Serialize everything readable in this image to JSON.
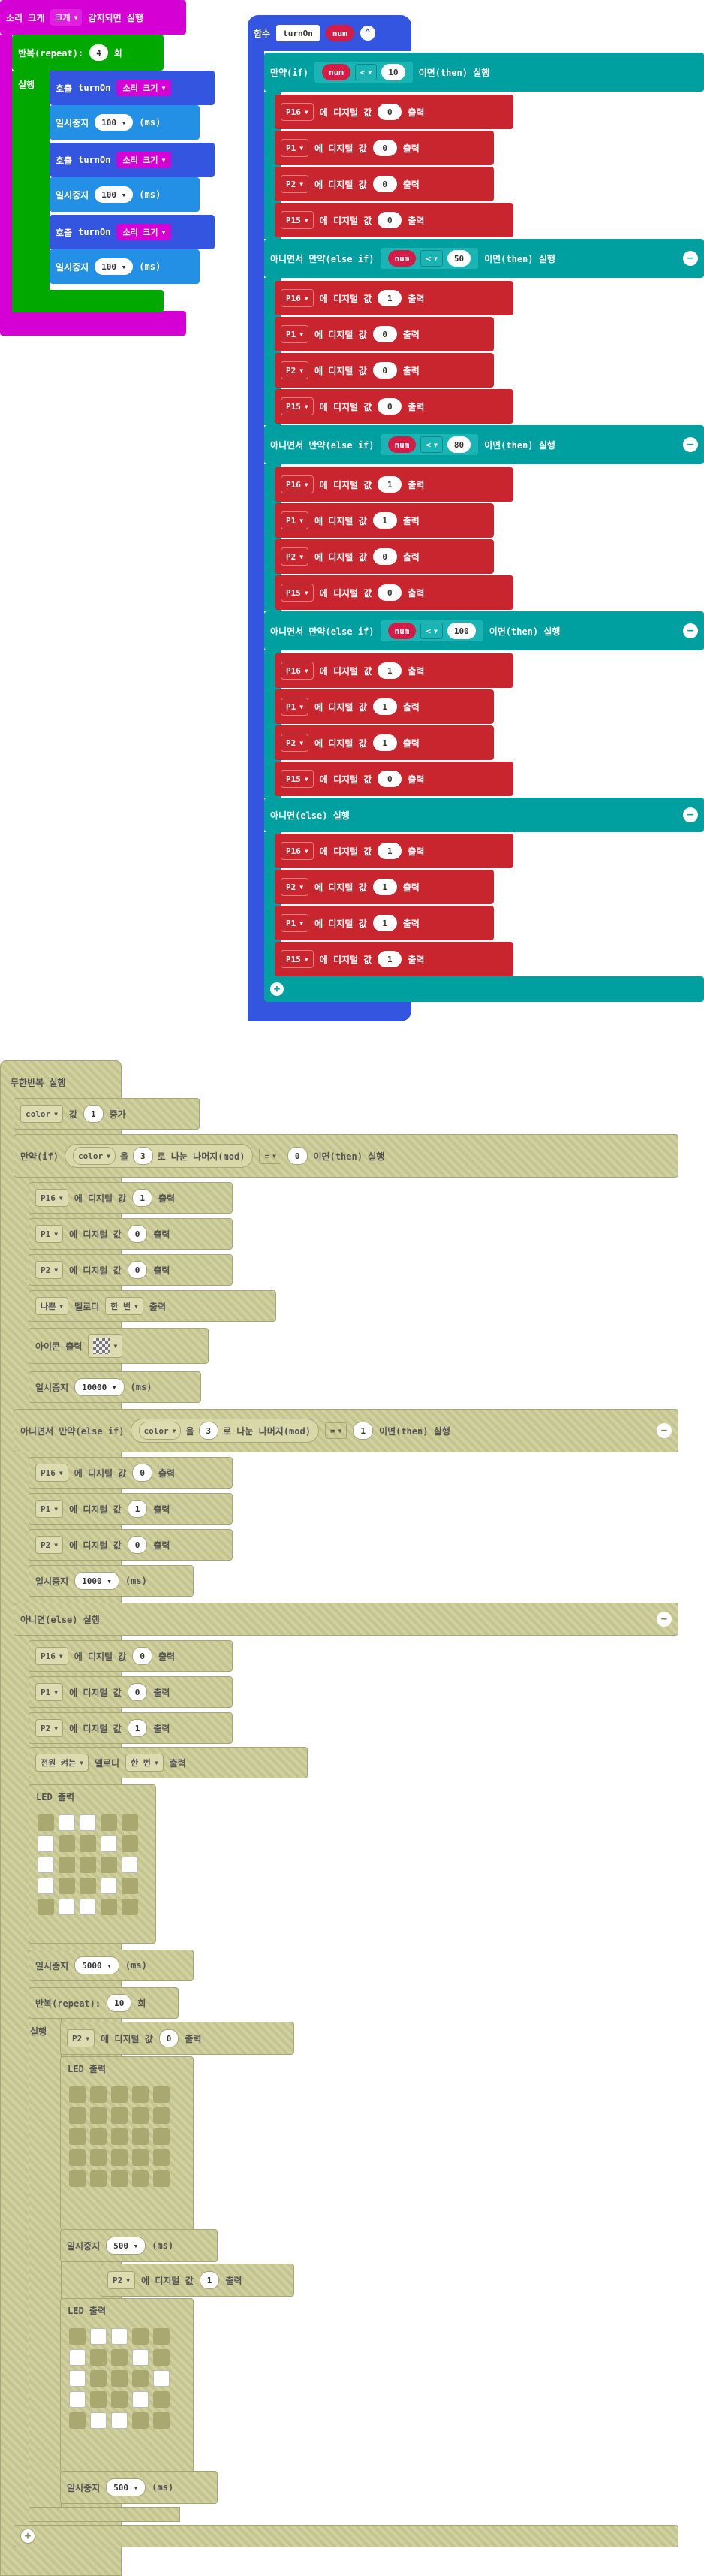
{
  "colors": {
    "magenta": "#d400d4",
    "green": "#00a800",
    "blue": "#3355e0",
    "sky": "#2390e6",
    "teal": "#00a0a0",
    "red": "#c8252e",
    "num": "#d41c47",
    "olive": "#c9c994"
  },
  "sound": {
    "title": "소리 크게",
    "trigger": "감지되면 실행",
    "repeat_label": "반복(repeat):",
    "repeat_count": "4",
    "repeat_unit": "회",
    "do_label": "실행",
    "call": "호출",
    "fn_name": "turnOn",
    "arg": "소리 크기",
    "pause": "일시중지",
    "pause_value": "100",
    "ms": "(ms)"
  },
  "func": {
    "label": "함수",
    "name": "turnOn",
    "param": "num",
    "if_label": "만약(if)",
    "elseif_label": "아니면서 만약(else if)",
    "else_label": "아니면(else) 실행",
    "then_label": "이면(then) 실행",
    "op": "<",
    "branches": [
      {
        "value": "10",
        "pins": [
          {
            "pin": "P16",
            "v": "0"
          },
          {
            "pin": "P1",
            "v": "0"
          },
          {
            "pin": "P2",
            "v": "0"
          },
          {
            "pin": "P15",
            "v": "0"
          }
        ]
      },
      {
        "value": "50",
        "pins": [
          {
            "pin": "P16",
            "v": "1"
          },
          {
            "pin": "P1",
            "v": "0"
          },
          {
            "pin": "P2",
            "v": "0"
          },
          {
            "pin": "P15",
            "v": "0"
          }
        ]
      },
      {
        "value": "80",
        "pins": [
          {
            "pin": "P16",
            "v": "1"
          },
          {
            "pin": "P1",
            "v": "1"
          },
          {
            "pin": "P2",
            "v": "0"
          },
          {
            "pin": "P15",
            "v": "0"
          }
        ]
      },
      {
        "value": "100",
        "pins": [
          {
            "pin": "P16",
            "v": "1"
          },
          {
            "pin": "P1",
            "v": "1"
          },
          {
            "pin": "P2",
            "v": "1"
          },
          {
            "pin": "P15",
            "v": "0"
          }
        ]
      }
    ],
    "else_pins": [
      {
        "pin": "P16",
        "v": "1"
      },
      {
        "pin": "P2",
        "v": "1"
      },
      {
        "pin": "P1",
        "v": "1"
      },
      {
        "pin": "P15",
        "v": "1"
      }
    ]
  },
  "digital": {
    "write": "에 디지털 값",
    "out": "출력"
  },
  "forever": {
    "title": "무한반복 실행",
    "color_var": "color",
    "change_by": "값",
    "change_val": "1",
    "increase": "증가",
    "if_label": "만약(if)",
    "mod_of": "을",
    "mod_div": "3",
    "mod_text": "로 나눈 나머지(mod)",
    "eq": "=",
    "then_label": "이면(then) 실행",
    "elseif_label": "아니면서 만약(else if)",
    "else_label": "아니면(else) 실행",
    "if_eq": "0",
    "elseif_eq": "1",
    "b1_pins": [
      {
        "pin": "P16",
        "v": "1"
      },
      {
        "pin": "P1",
        "v": "0"
      },
      {
        "pin": "P2",
        "v": "0"
      }
    ],
    "melody1": "나쁜",
    "melody_label": "멜로디",
    "once": "한 번",
    "out": "출력",
    "icon_label": "아이콘 출력",
    "pause1": "10000",
    "b2_pins": [
      {
        "pin": "P16",
        "v": "0"
      },
      {
        "pin": "P1",
        "v": "1"
      },
      {
        "pin": "P2",
        "v": "0"
      }
    ],
    "pause2": "1000",
    "b3_pins": [
      {
        "pin": "P16",
        "v": "0"
      },
      {
        "pin": "P1",
        "v": "0"
      },
      {
        "pin": "P2",
        "v": "1"
      }
    ],
    "melody2": "전원 켜는",
    "led_label": "LED 출력",
    "pause3": "5000",
    "repeat_label": "반복(repeat):",
    "repeat_count": "10",
    "repeat_unit": "회",
    "do_label": "실행",
    "inner_pin": "P2",
    "inner_v1": "0",
    "inner_v2": "1",
    "pause_inner": "500",
    "pause_word": "일시중지",
    "ms": "(ms)"
  }
}
